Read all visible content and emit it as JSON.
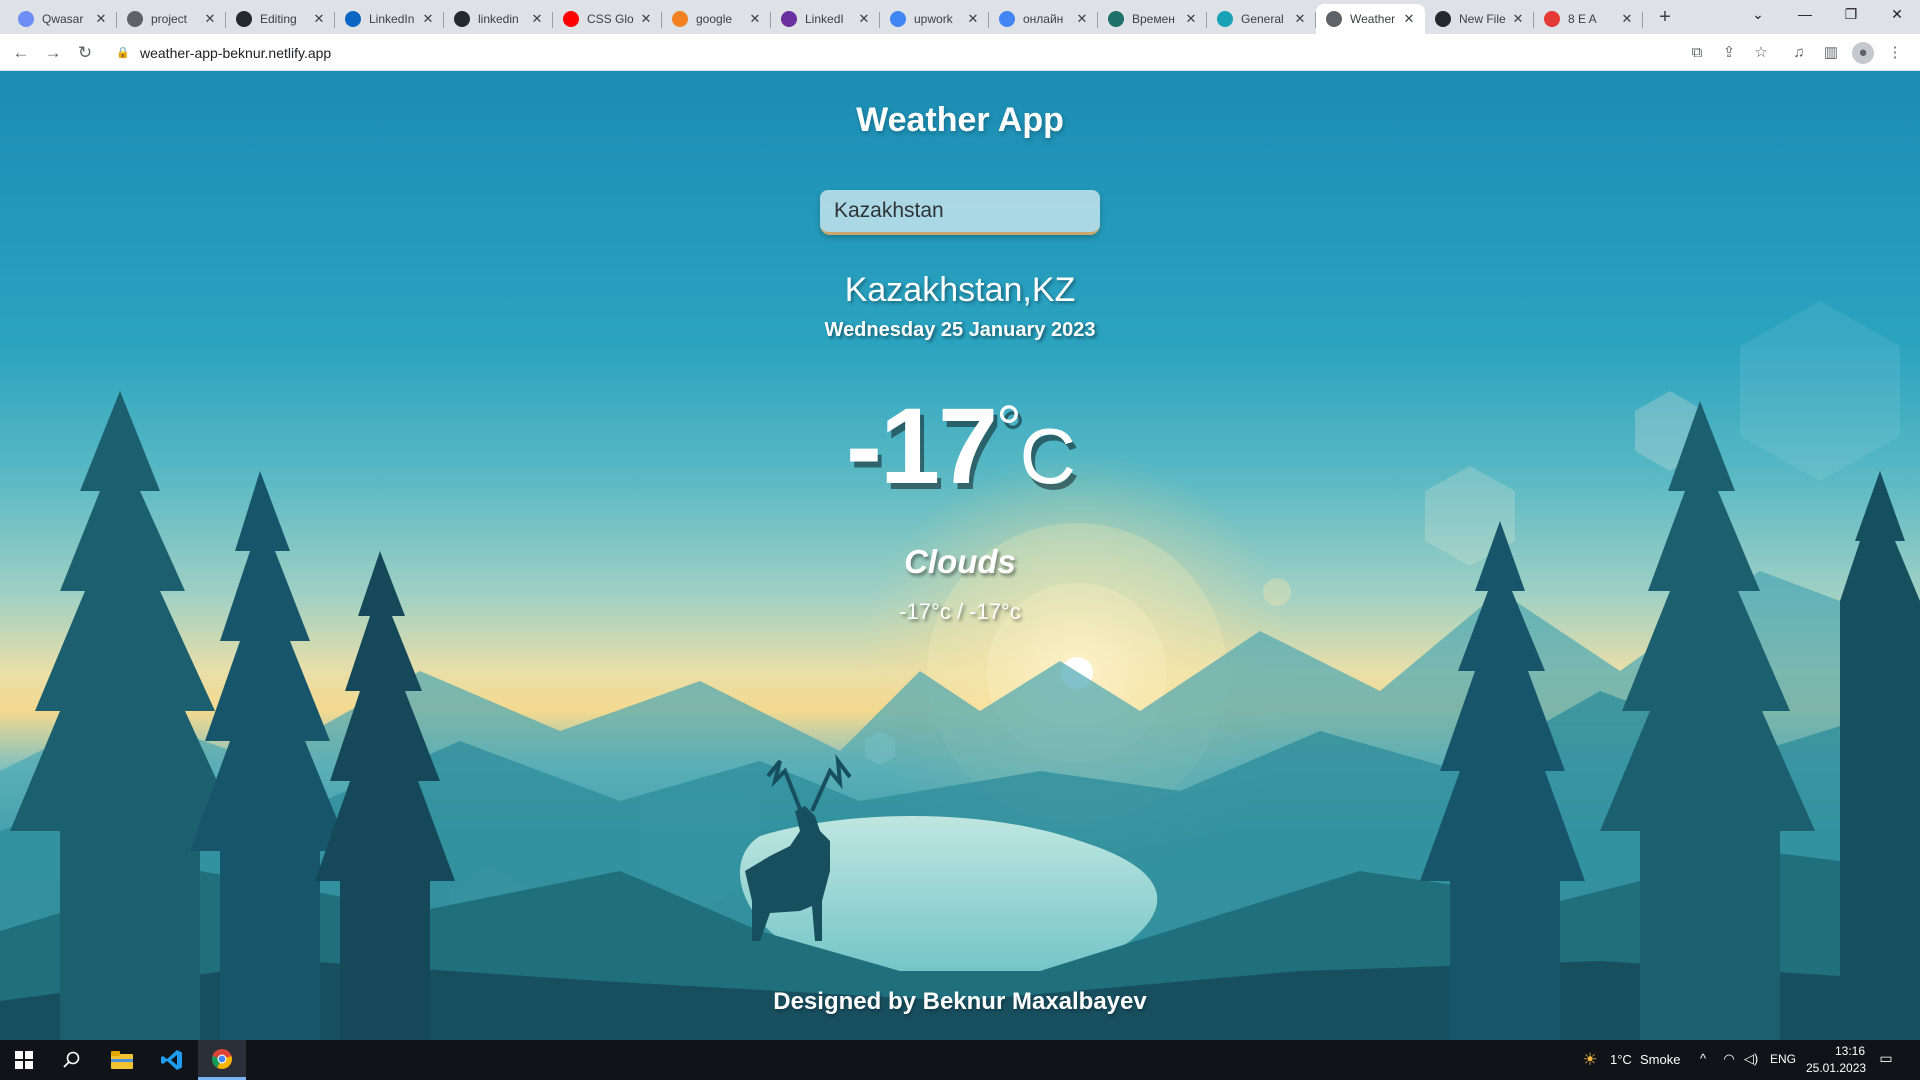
{
  "browser": {
    "tabs": [
      {
        "title": "Qwasar",
        "favicon_color": "#6c8ef5"
      },
      {
        "title": "project",
        "favicon_color": "#5f6368"
      },
      {
        "title": "Editing",
        "favicon_color": "#24292f"
      },
      {
        "title": "LinkedIn",
        "favicon_color": "#0a66c2"
      },
      {
        "title": "linkedin",
        "favicon_color": "#24292f"
      },
      {
        "title": "CSS Glo",
        "favicon_color": "#ff0000"
      },
      {
        "title": "google",
        "favicon_color": "#f48024"
      },
      {
        "title": "LinkedI",
        "favicon_color": "#6b2fa0"
      },
      {
        "title": "upwork",
        "favicon_color": "#4285f4"
      },
      {
        "title": "онлайн",
        "favicon_color": "#4285f4"
      },
      {
        "title": "Времен",
        "favicon_color": "#1f6f6a"
      },
      {
        "title": "General",
        "favicon_color": "#17a2b8"
      },
      {
        "title": "Weather",
        "favicon_color": "#5f6368"
      },
      {
        "title": "New File",
        "favicon_color": "#24292f"
      },
      {
        "title": "8 E A",
        "favicon_color": "#e53935"
      }
    ],
    "active_tab_index": 12,
    "url": "weather-app-beknur.netlify.app"
  },
  "app": {
    "title": "Weather App",
    "search_value": "Kazakhstan",
    "location": "Kazakhstan,KZ",
    "date": "Wednesday 25 January 2023",
    "temp_value": "-17",
    "temp_degree": "°",
    "temp_unit": "C",
    "condition": "Clouds",
    "hi_lo": "-17°c / -17°c",
    "footer": "Designed by Beknur Maxalbayev"
  },
  "taskbar": {
    "weather_temp": "1°C",
    "weather_desc": "Smoke",
    "language": "ENG",
    "time": "13:16",
    "date": "25.01.2023"
  },
  "colors": {
    "sky_top": "#1b8cb3",
    "sun_glow": "#f4d98f",
    "forest": "#1f6c7c",
    "accent_underline": "#c9a66b"
  }
}
